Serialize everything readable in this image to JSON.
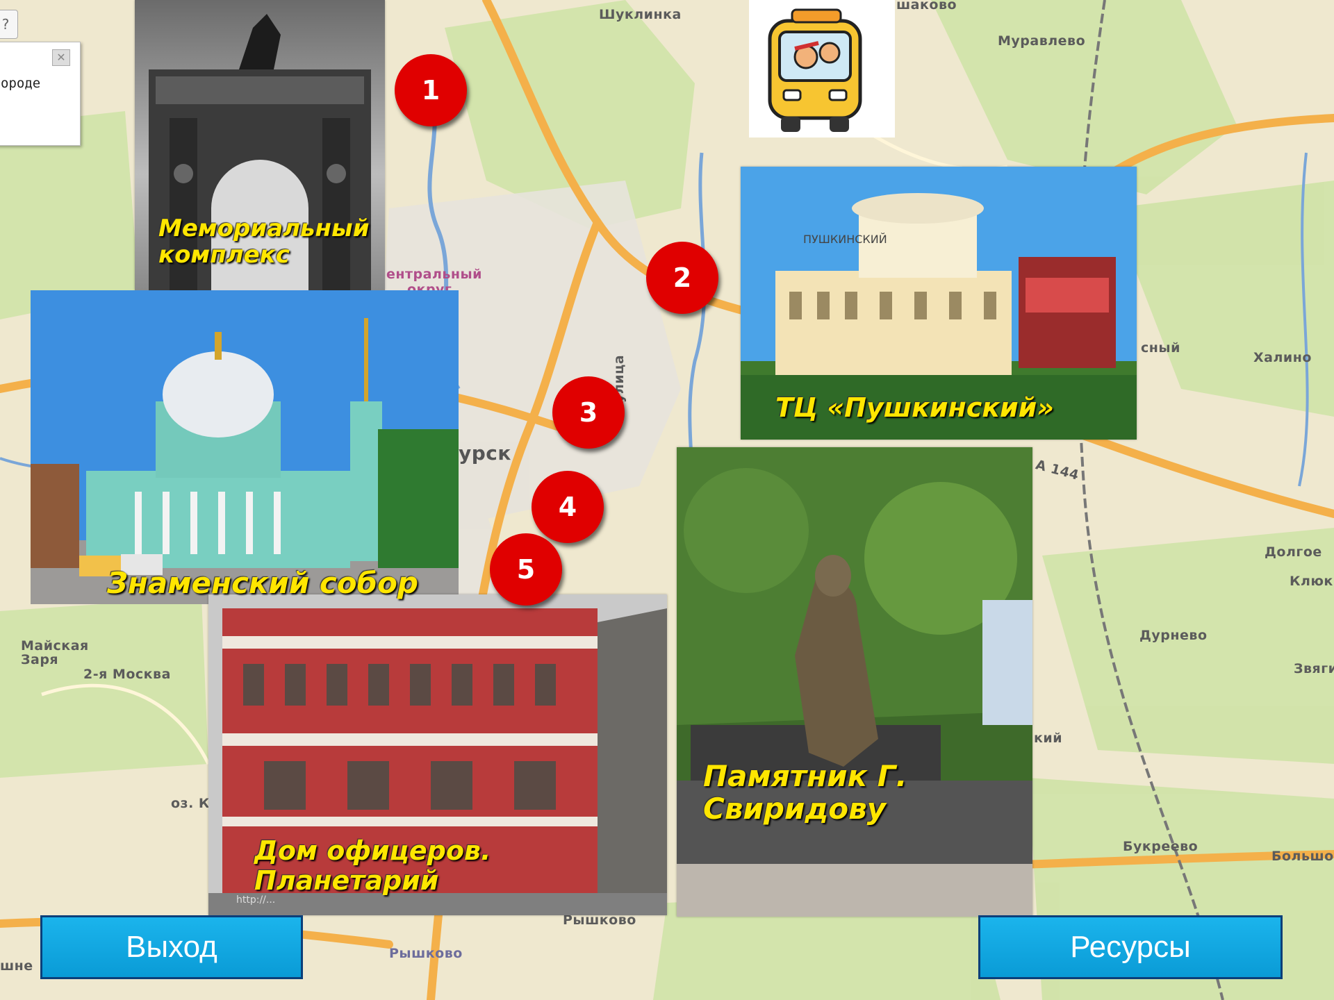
{
  "map_labels": {
    "shuklinka": "Шуклинка",
    "shakovo": "шаково",
    "muravlevo": "Муравлево",
    "central": "ентральный",
    "okrug": "округ",
    "kursk": "урск",
    "ulitsa": "улица",
    "road": "А 144",
    "yasny": "сный",
    "khalino": "Халино",
    "dolgoe": "Долгое",
    "klyuk": "Клюк",
    "durnevo": "Дурнево",
    "zvyag": "Звяги",
    "maiskaya_zarya": "Майская Заря",
    "moskva2": "2-я Москва",
    "oz": "оз. Кр",
    "kiy": "кий",
    "bukreevo": "Букреево",
    "bolshoe": "Большо",
    "ryshkovo": "Рышково",
    "ryshkovo_station": "Рышково",
    "shne": "шне"
  },
  "popup": {
    "text": "ороде",
    "close_glyph": "✕",
    "tool_glyph": "?"
  },
  "markers": [
    "1",
    "2",
    "3",
    "4",
    "5"
  ],
  "photos": {
    "memorial": {
      "caption": "Мемориальный комплекс"
    },
    "pushkinsky": {
      "caption": "ТЦ «Пушкинский»",
      "sign": "ПУШКИНСКИЙ"
    },
    "znamensky": {
      "caption": "Знаменский собор"
    },
    "officers": {
      "caption": "Дом офицеров. Планетарий",
      "watermark": "http://..."
    },
    "sviridov": {
      "caption": "Памятник Г. Свиридову"
    }
  },
  "buttons": {
    "exit": "Выход",
    "resources": "Ресурсы"
  },
  "colors": {
    "marker": "#e00000",
    "button": "#12a8e4",
    "button_border": "#0b3f7a",
    "caption": "#ffe600",
    "road_major": "#f4b04a",
    "greenery": "#cfe3a7"
  }
}
